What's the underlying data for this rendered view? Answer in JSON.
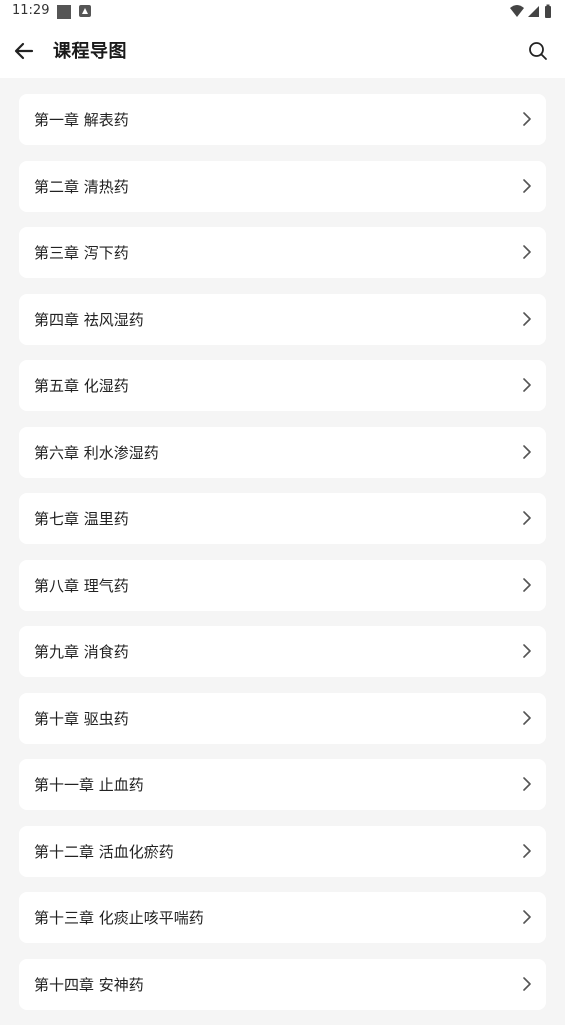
{
  "status_bar": {
    "time": "11:29"
  },
  "header": {
    "title": "课程导图",
    "back_icon": "arrow-left-icon",
    "search_icon": "search-icon"
  },
  "chapters": [
    {
      "label": "第一章 解表药"
    },
    {
      "label": "第二章 清热药"
    },
    {
      "label": "第三章 泻下药"
    },
    {
      "label": "第四章 祛风湿药"
    },
    {
      "label": "第五章 化湿药"
    },
    {
      "label": "第六章 利水渗湿药"
    },
    {
      "label": "第七章 温里药"
    },
    {
      "label": "第八章 理气药"
    },
    {
      "label": "第九章 消食药"
    },
    {
      "label": "第十章 驱虫药"
    },
    {
      "label": "第十一章 止血药"
    },
    {
      "label": "第十二章 活血化瘀药"
    },
    {
      "label": "第十三章 化痰止咳平喘药"
    },
    {
      "label": "第十四章 安神药"
    }
  ],
  "colors": {
    "background": "#f5f5f5",
    "card": "#ffffff",
    "text": "#222222",
    "chevron": "#555555"
  }
}
